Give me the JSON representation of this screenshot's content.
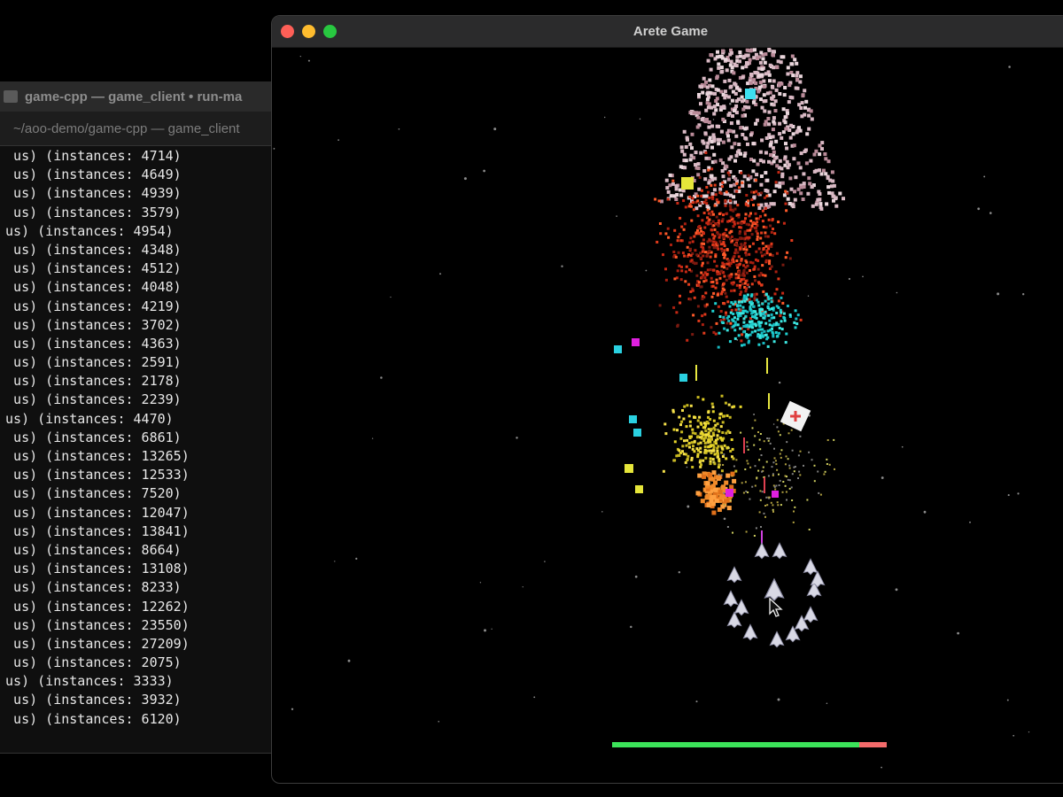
{
  "terminal": {
    "title": "game-cpp — game_client • run-ma",
    "tab_path": "~/aoo-demo/game-cpp — game_client",
    "lines": [
      "  us) (instances: 4714)",
      "  us) (instances: 4649)",
      "  us) (instances: 4939)",
      "  us) (instances: 3579)",
      " us) (instances: 4954)",
      "  us) (instances: 4348)",
      "  us) (instances: 4512)",
      "  us) (instances: 4048)",
      "  us) (instances: 4219)",
      "  us) (instances: 3702)",
      "  us) (instances: 4363)",
      "  us) (instances: 2591)",
      "  us) (instances: 2178)",
      "  us) (instances: 2239)",
      " us) (instances: 4470)",
      "  us) (instances: 6861)",
      "  us) (instances: 13265)",
      "  us) (instances: 12533)",
      "  us) (instances: 7520)",
      "  us) (instances: 12047)",
      "  us) (instances: 13841)",
      "  us) (instances: 8664)",
      "  us) (instances: 13108)",
      "  us) (instances: 8233)",
      "  us) (instances: 12262)",
      "  us) (instances: 23550)",
      "  us) (instances: 27209)",
      "  us) (instances: 2075)",
      " us) (instances: 3333)",
      "  us) (instances: 3932)",
      "  us) (instances: 6120)"
    ]
  },
  "game_window": {
    "title": "Arete Game",
    "health_fraction": 0.9,
    "colors": {
      "health": "#3ce35a",
      "damage": "#f36b6b",
      "background": "#000000"
    },
    "icons": [
      "close-icon",
      "minimize-icon",
      "maximize-icon",
      "cursor-icon"
    ]
  }
}
